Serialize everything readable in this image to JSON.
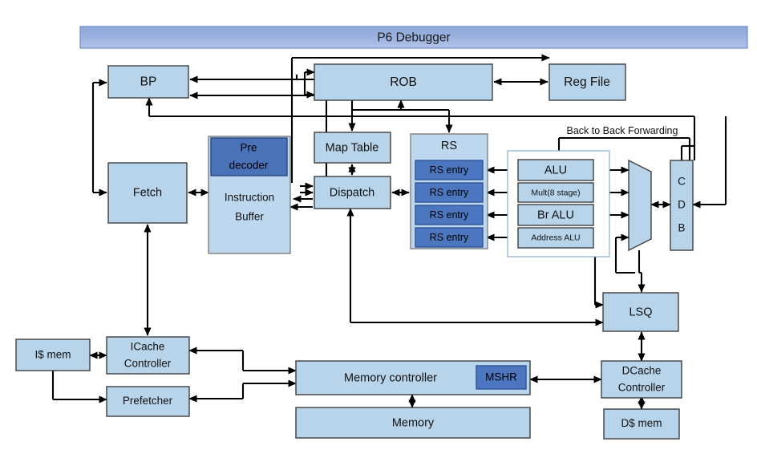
{
  "title_bar": {
    "label": "P6 Debugger",
    "gradient_top": "#8ea9db",
    "gradient_bottom": "#adbde4"
  },
  "colors": {
    "box_light": "#b8d4ea",
    "box_dark": "#4a72b8",
    "box_outline": "#3f3f3f",
    "container_outline": "#8eb4d8",
    "connector": "#000000"
  },
  "blocks": {
    "bp": "BP",
    "rob": "ROB",
    "reg_file": "Reg File",
    "map_table": "Map Table",
    "dispatch": "Dispatch",
    "pre_decoder_line1": "Pre",
    "pre_decoder_line2": "decoder",
    "instruction_buffer_line1": "Instruction",
    "instruction_buffer_line2": "Buffer",
    "fetch": "Fetch",
    "rs": "RS",
    "rs_entries": [
      "RS entry",
      "RS entry",
      "RS entry",
      "RS entry"
    ],
    "functional_units": [
      "ALU",
      "Mult(8 stage)",
      "Br ALU",
      "Address ALU"
    ],
    "cdb_letters": [
      "C",
      "D",
      "B"
    ],
    "lsq": "LSQ",
    "icache_controller_line1": "ICache",
    "icache_controller_line2": "Controller",
    "i_mem": "I$ mem",
    "prefetcher": "Prefetcher",
    "memory_controller": "Memory controller",
    "mshr": "MSHR",
    "memory": "Memory",
    "dcache_controller_line1": "DCache",
    "dcache_controller_line2": "Controller",
    "d_mem": "D$ mem"
  },
  "annotations": {
    "back_to_back_forwarding": "Back to Back Forwarding"
  }
}
